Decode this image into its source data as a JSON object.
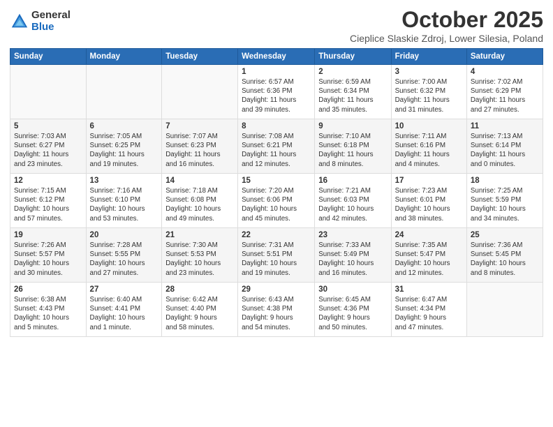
{
  "logo": {
    "general": "General",
    "blue": "Blue"
  },
  "title": "October 2025",
  "location": "Cieplice Slaskie Zdroj, Lower Silesia, Poland",
  "days_of_week": [
    "Sunday",
    "Monday",
    "Tuesday",
    "Wednesday",
    "Thursday",
    "Friday",
    "Saturday"
  ],
  "weeks": [
    [
      {
        "day": "",
        "info": ""
      },
      {
        "day": "",
        "info": ""
      },
      {
        "day": "",
        "info": ""
      },
      {
        "day": "1",
        "info": "Sunrise: 6:57 AM\nSunset: 6:36 PM\nDaylight: 11 hours\nand 39 minutes."
      },
      {
        "day": "2",
        "info": "Sunrise: 6:59 AM\nSunset: 6:34 PM\nDaylight: 11 hours\nand 35 minutes."
      },
      {
        "day": "3",
        "info": "Sunrise: 7:00 AM\nSunset: 6:32 PM\nDaylight: 11 hours\nand 31 minutes."
      },
      {
        "day": "4",
        "info": "Sunrise: 7:02 AM\nSunset: 6:29 PM\nDaylight: 11 hours\nand 27 minutes."
      }
    ],
    [
      {
        "day": "5",
        "info": "Sunrise: 7:03 AM\nSunset: 6:27 PM\nDaylight: 11 hours\nand 23 minutes."
      },
      {
        "day": "6",
        "info": "Sunrise: 7:05 AM\nSunset: 6:25 PM\nDaylight: 11 hours\nand 19 minutes."
      },
      {
        "day": "7",
        "info": "Sunrise: 7:07 AM\nSunset: 6:23 PM\nDaylight: 11 hours\nand 16 minutes."
      },
      {
        "day": "8",
        "info": "Sunrise: 7:08 AM\nSunset: 6:21 PM\nDaylight: 11 hours\nand 12 minutes."
      },
      {
        "day": "9",
        "info": "Sunrise: 7:10 AM\nSunset: 6:18 PM\nDaylight: 11 hours\nand 8 minutes."
      },
      {
        "day": "10",
        "info": "Sunrise: 7:11 AM\nSunset: 6:16 PM\nDaylight: 11 hours\nand 4 minutes."
      },
      {
        "day": "11",
        "info": "Sunrise: 7:13 AM\nSunset: 6:14 PM\nDaylight: 11 hours\nand 0 minutes."
      }
    ],
    [
      {
        "day": "12",
        "info": "Sunrise: 7:15 AM\nSunset: 6:12 PM\nDaylight: 10 hours\nand 57 minutes."
      },
      {
        "day": "13",
        "info": "Sunrise: 7:16 AM\nSunset: 6:10 PM\nDaylight: 10 hours\nand 53 minutes."
      },
      {
        "day": "14",
        "info": "Sunrise: 7:18 AM\nSunset: 6:08 PM\nDaylight: 10 hours\nand 49 minutes."
      },
      {
        "day": "15",
        "info": "Sunrise: 7:20 AM\nSunset: 6:06 PM\nDaylight: 10 hours\nand 45 minutes."
      },
      {
        "day": "16",
        "info": "Sunrise: 7:21 AM\nSunset: 6:03 PM\nDaylight: 10 hours\nand 42 minutes."
      },
      {
        "day": "17",
        "info": "Sunrise: 7:23 AM\nSunset: 6:01 PM\nDaylight: 10 hours\nand 38 minutes."
      },
      {
        "day": "18",
        "info": "Sunrise: 7:25 AM\nSunset: 5:59 PM\nDaylight: 10 hours\nand 34 minutes."
      }
    ],
    [
      {
        "day": "19",
        "info": "Sunrise: 7:26 AM\nSunset: 5:57 PM\nDaylight: 10 hours\nand 30 minutes."
      },
      {
        "day": "20",
        "info": "Sunrise: 7:28 AM\nSunset: 5:55 PM\nDaylight: 10 hours\nand 27 minutes."
      },
      {
        "day": "21",
        "info": "Sunrise: 7:30 AM\nSunset: 5:53 PM\nDaylight: 10 hours\nand 23 minutes."
      },
      {
        "day": "22",
        "info": "Sunrise: 7:31 AM\nSunset: 5:51 PM\nDaylight: 10 hours\nand 19 minutes."
      },
      {
        "day": "23",
        "info": "Sunrise: 7:33 AM\nSunset: 5:49 PM\nDaylight: 10 hours\nand 16 minutes."
      },
      {
        "day": "24",
        "info": "Sunrise: 7:35 AM\nSunset: 5:47 PM\nDaylight: 10 hours\nand 12 minutes."
      },
      {
        "day": "25",
        "info": "Sunrise: 7:36 AM\nSunset: 5:45 PM\nDaylight: 10 hours\nand 8 minutes."
      }
    ],
    [
      {
        "day": "26",
        "info": "Sunrise: 6:38 AM\nSunset: 4:43 PM\nDaylight: 10 hours\nand 5 minutes."
      },
      {
        "day": "27",
        "info": "Sunrise: 6:40 AM\nSunset: 4:41 PM\nDaylight: 10 hours\nand 1 minute."
      },
      {
        "day": "28",
        "info": "Sunrise: 6:42 AM\nSunset: 4:40 PM\nDaylight: 9 hours\nand 58 minutes."
      },
      {
        "day": "29",
        "info": "Sunrise: 6:43 AM\nSunset: 4:38 PM\nDaylight: 9 hours\nand 54 minutes."
      },
      {
        "day": "30",
        "info": "Sunrise: 6:45 AM\nSunset: 4:36 PM\nDaylight: 9 hours\nand 50 minutes."
      },
      {
        "day": "31",
        "info": "Sunrise: 6:47 AM\nSunset: 4:34 PM\nDaylight: 9 hours\nand 47 minutes."
      },
      {
        "day": "",
        "info": ""
      }
    ]
  ]
}
